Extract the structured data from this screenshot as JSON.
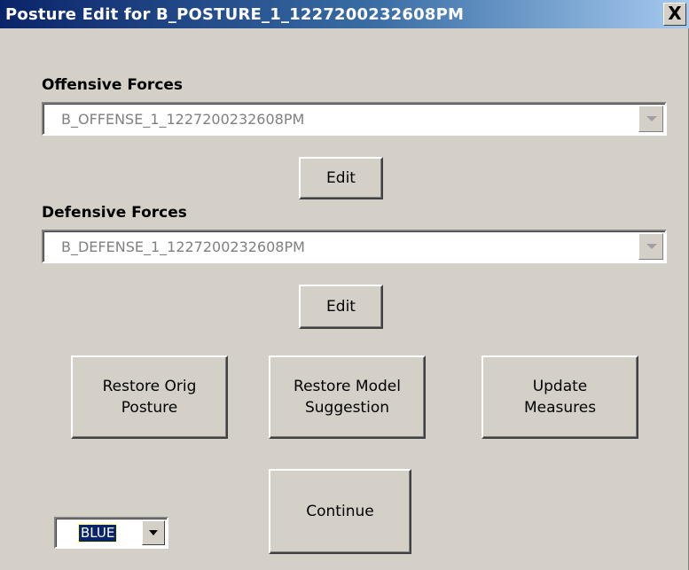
{
  "window": {
    "title": "Posture Edit for B_POSTURE_1_1227200232608PM",
    "close_glyph": "X"
  },
  "offensive": {
    "label": "Offensive Forces",
    "value": "B_OFFENSE_1_1227200232608PM",
    "edit_label": "Edit"
  },
  "defensive": {
    "label": "Defensive Forces",
    "value": "B_DEFENSE_1_1227200232608PM",
    "edit_label": "Edit"
  },
  "actions": {
    "restore_orig": "Restore Orig\nPosture",
    "restore_model": "Restore Model\nSuggestion",
    "update_measures": "Update\nMeasures",
    "continue": "Continue"
  },
  "side_select": {
    "value": "BLUE"
  },
  "colors": {
    "titlebar_start": "#0a246a",
    "titlebar_end": "#a6caf0",
    "face": "#d4d0c8",
    "selection": "#0a246a"
  }
}
